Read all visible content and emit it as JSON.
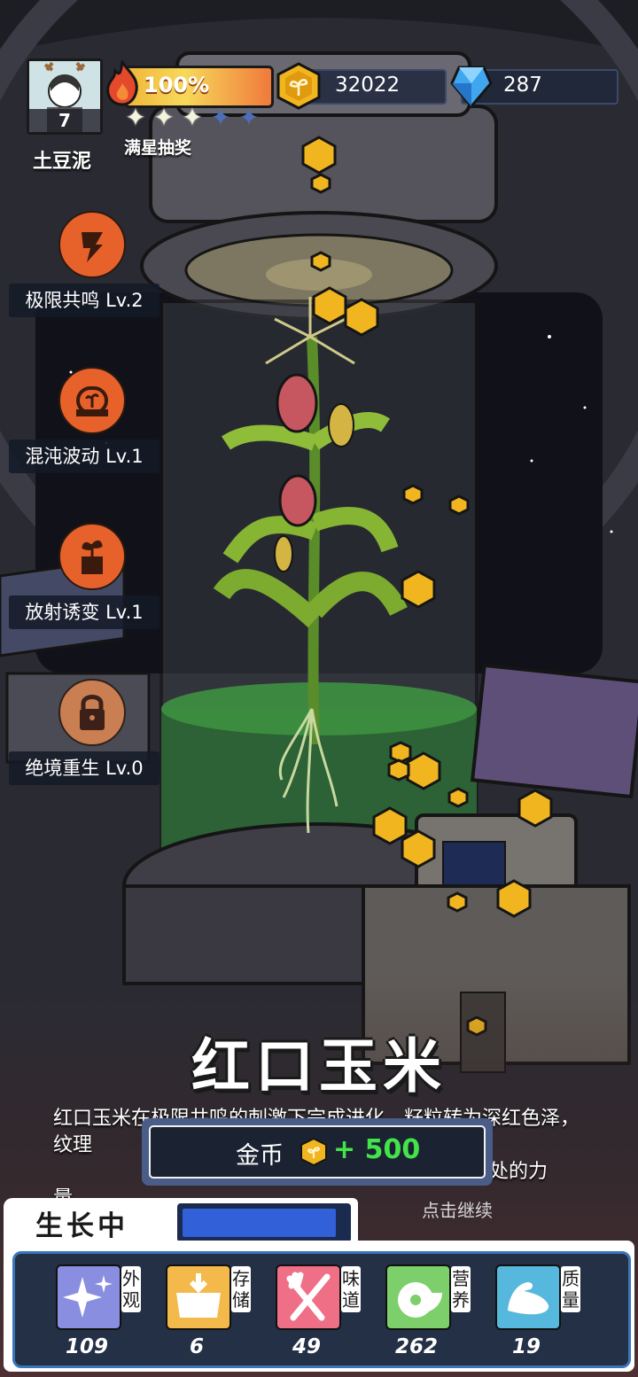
{
  "player": {
    "name": "土豆泥",
    "level": "7"
  },
  "energy": {
    "percent_text": "100%",
    "star_reward_label": "满星抽奖",
    "stars_filled": 3,
    "stars_total": 5
  },
  "currency": {
    "coins": "32022",
    "gems": "287"
  },
  "skills": [
    {
      "label": "极限共鸣 Lv.2",
      "icon": "resonance-icon",
      "locked": false
    },
    {
      "label": "混沌波动 Lv.1",
      "icon": "chaos-wave-icon",
      "locked": false
    },
    {
      "label": "放射诱变 Lv.1",
      "icon": "radiation-mutation-icon",
      "locked": false
    },
    {
      "label": "绝境重生 Lv.0",
      "icon": "lock-icon",
      "locked": true
    }
  ],
  "crop": {
    "title": "红口玉米",
    "description": "红口玉米在极限共鸣的刺激下完成进化，籽粒转为深红色泽，纹理",
    "description_line2": "处的力",
    "description_line3": "量。"
  },
  "reward": {
    "label": "金币",
    "amount": "+ 500"
  },
  "continue_hint": "点击继续",
  "growth": {
    "label": "生长中",
    "progress": 0.94
  },
  "stats": [
    {
      "name": "外观",
      "value": "109",
      "icon": "sparkle-icon",
      "color": "#8a8ee0"
    },
    {
      "name": "存储",
      "value": "6",
      "icon": "storage-box-icon",
      "color": "#f3b94a"
    },
    {
      "name": "味道",
      "value": "49",
      "icon": "fork-knife-icon",
      "color": "#ee6f86"
    },
    {
      "name": "营养",
      "value": "262",
      "icon": "lime-icon",
      "color": "#7ccf6a"
    },
    {
      "name": "质量",
      "value": "19",
      "icon": "muscle-icon",
      "color": "#56b8dc"
    }
  ],
  "colors": {
    "accent_orange": "#e7612a",
    "reward_green": "#43e34a",
    "growth_blue": "#3160d8"
  }
}
